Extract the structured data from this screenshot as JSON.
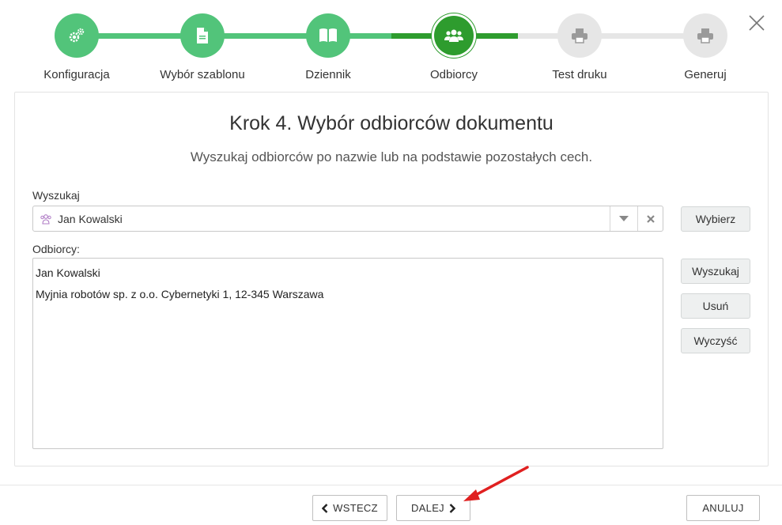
{
  "stepper": {
    "steps": [
      {
        "label": "Konfiguracja",
        "icon": "gears-icon",
        "state": "done"
      },
      {
        "label": "Wybór szablonu",
        "icon": "document-icon",
        "state": "done"
      },
      {
        "label": "Dziennik",
        "icon": "book-icon",
        "state": "done"
      },
      {
        "label": "Odbiorcy",
        "icon": "users-icon",
        "state": "current"
      },
      {
        "label": "Test druku",
        "icon": "printer-icon",
        "state": "todo"
      },
      {
        "label": "Generuj",
        "icon": "printer-icon",
        "state": "todo"
      }
    ],
    "colors": {
      "done": "#52c47a",
      "current": "#2e9c2e",
      "todo": "#e6e6e6"
    }
  },
  "main": {
    "title": "Krok 4. Wybór odbiorców dokumentu",
    "subtitle": "Wyszukaj odbiorców po nazwie lub na podstawie pozostałych cech.",
    "search_label": "Wyszukaj",
    "search_value": "Jan Kowalski",
    "select_button": "Wybierz",
    "recipients_label": "Odbiorcy:",
    "recipients": [
      "Jan Kowalski",
      "Myjnia robotów sp. z o.o. Cybernetyki 1, 12-345 Warszawa"
    ],
    "buttons": {
      "search": "Wyszukaj",
      "remove": "Usuń",
      "clear": "Wyczyść"
    }
  },
  "footer": {
    "back": "WSTECZ",
    "next": "DALEJ",
    "cancel": "ANULUJ"
  },
  "annotation": {
    "arrow_color": "#e02020"
  }
}
